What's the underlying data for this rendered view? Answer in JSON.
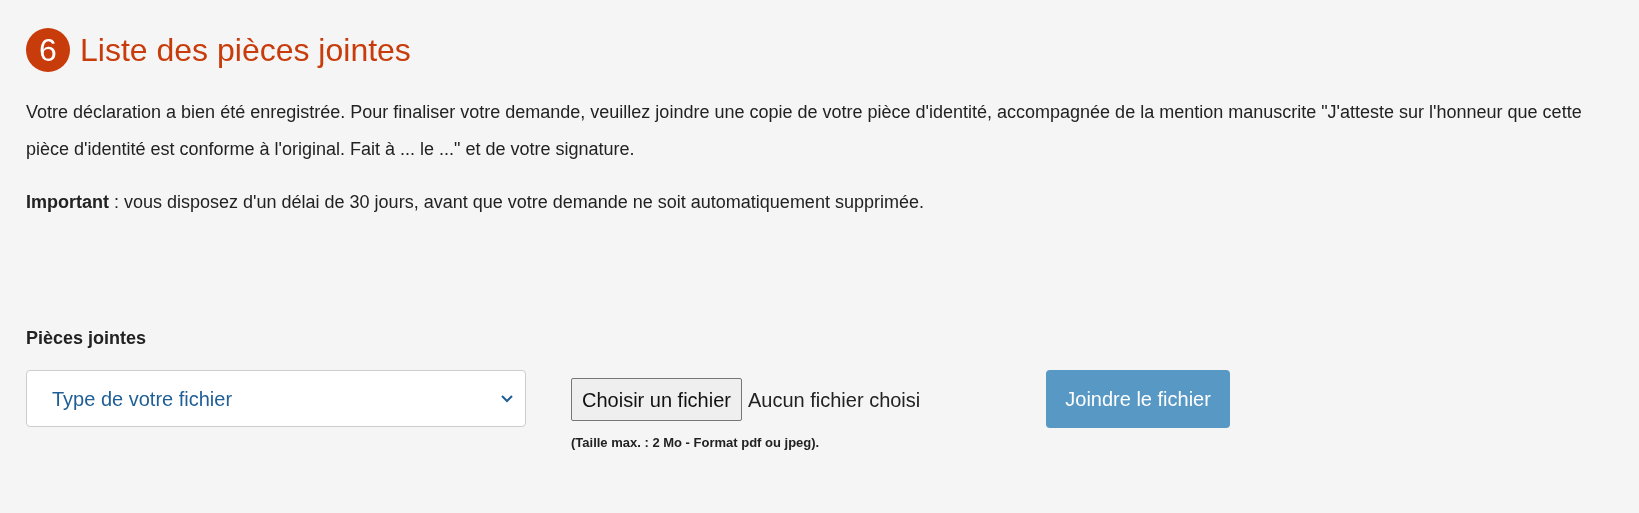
{
  "section": {
    "number": "6",
    "title": "Liste des pièces jointes"
  },
  "paragraphs": [
    "Votre déclaration a bien été enregistrée. Pour finaliser votre demande, veuillez joindre une copie de votre pièce d'identité, accompagnée de la mention manuscrite \"J'atteste sur l'honneur que cette pièce d'identité est conforme à l'original. Fait à ... le ...\" et de votre signature.",
    "**Important** : vous disposez d'un délai de 30 jours, avant que votre demande ne soit automatiquement supprimée."
  ],
  "attachments": {
    "label": "Pièces jointes",
    "file_type_select": {
      "placeholder": "Type de votre fichier"
    },
    "file_button": "Choisir un fichier",
    "file_status": "Aucun fichier choisi",
    "hint": "(Taille max. : 2 Mo - Format pdf ou jpeg).",
    "submit_button": "Joindre le fichier"
  }
}
